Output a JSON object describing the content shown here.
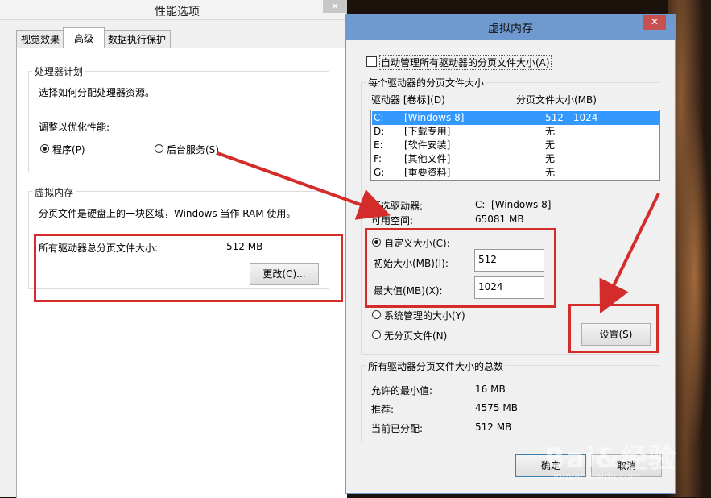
{
  "perf_window": {
    "title": "性能选项",
    "close": "✕",
    "tabs": [
      "视觉效果",
      "高级",
      "数据执行保护"
    ],
    "processor": {
      "legend": "处理器计划",
      "desc": "选择如何分配处理器资源。",
      "adjust_label": "调整以优化性能:",
      "option_programs": "程序(P)",
      "option_services": "后台服务(S)"
    },
    "virtual_memory": {
      "legend": "虚拟内存",
      "desc": "分页文件是硬盘上的一块区域，Windows 当作 RAM 使用。",
      "total_label": "所有驱动器总分页文件大小:",
      "total_value": "512 MB",
      "change_button": "更改(C)..."
    }
  },
  "vm_dialog": {
    "title": "虚拟内存",
    "close": "✕",
    "auto_manage": "自动管理所有驱动器的分页文件大小(A)",
    "per_drive_legend": "每个驱动器的分页文件大小",
    "col_drive": "驱动器 [卷标](D)",
    "col_size": "分页文件大小(MB)",
    "drives": [
      {
        "letter": "C:",
        "label": "[Windows 8]",
        "size": "512 - 1024"
      },
      {
        "letter": "D:",
        "label": "[下载专用]",
        "size": "无"
      },
      {
        "letter": "E:",
        "label": "[软件安装]",
        "size": "无"
      },
      {
        "letter": "F:",
        "label": "[其他文件]",
        "size": "无"
      },
      {
        "letter": "G:",
        "label": "[重要资料]",
        "size": "无"
      }
    ],
    "selected_drive_label": "所选驱动器:",
    "selected_drive_value": "C:  [Windows 8]",
    "available_space_label": "可用空间:",
    "available_space_value": "65081 MB",
    "custom_size": "自定义大小(C):",
    "initial_size_label": "初始大小(MB)(I):",
    "initial_size_value": "512",
    "max_size_label": "最大值(MB)(X):",
    "max_size_value": "1024",
    "system_managed": "系统管理的大小(Y)",
    "no_paging_file": "无分页文件(N)",
    "set_button": "设置(S)",
    "totals_legend": "所有驱动器分页文件大小的总数",
    "min_allowed_label": "允许的最小值:",
    "min_allowed_value": "16 MB",
    "recommended_label": "推荐:",
    "recommended_value": "4575 MB",
    "current_label": "当前已分配:",
    "current_value": "512 MB",
    "ok_button": "确定",
    "cancel_button": "取消"
  },
  "watermark": {
    "main": "Bai&经验",
    "sub": "jingyan.baidu.com"
  },
  "colors": {
    "annotation": "#d42b2b",
    "selection": "#3399ff",
    "titlebar_vm": "#6f9ad0"
  }
}
